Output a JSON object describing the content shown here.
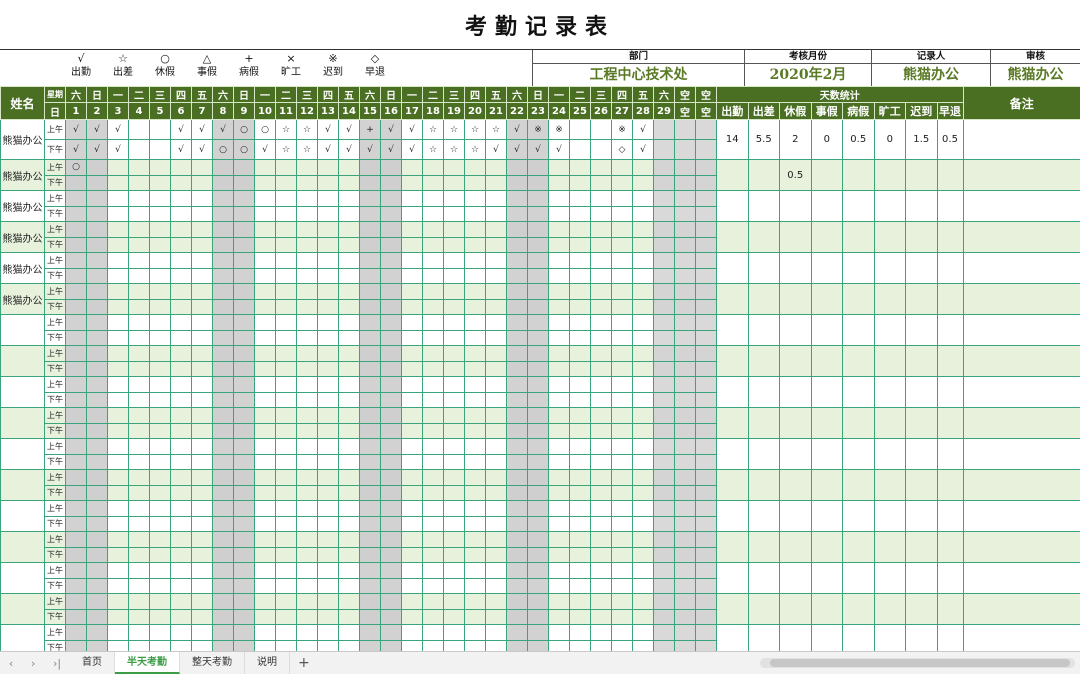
{
  "title": "考勤记录表",
  "legend": [
    {
      "sym": "√",
      "label": "出勤"
    },
    {
      "sym": "☆",
      "label": "出差"
    },
    {
      "sym": "○",
      "label": "休假"
    },
    {
      "sym": "△",
      "label": "事假"
    },
    {
      "sym": "+",
      "label": "病假"
    },
    {
      "sym": "×",
      "label": "旷工"
    },
    {
      "sym": "※",
      "label": "迟到"
    },
    {
      "sym": "◇",
      "label": "早退"
    }
  ],
  "meta": {
    "dept_label": "部门",
    "dept_value": "工程中心技术处",
    "month_label": "考核月份",
    "month_value": "2020年2月",
    "recorder_label": "记录人",
    "recorder_value": "熊猫办公",
    "review_label": "审核",
    "review_value": "熊猫办公"
  },
  "header": {
    "name": "姓名",
    "week_label": "星期",
    "date_label": "日",
    "weekdays": [
      "六",
      "日",
      "一",
      "二",
      "三",
      "四",
      "五",
      "六",
      "日",
      "一",
      "二",
      "三",
      "四",
      "五",
      "六",
      "日",
      "一",
      "二",
      "三",
      "四",
      "五",
      "六",
      "日",
      "一",
      "二",
      "三",
      "四",
      "五",
      "六",
      "空",
      "空"
    ],
    "days": [
      "1",
      "2",
      "3",
      "4",
      "5",
      "6",
      "7",
      "8",
      "9",
      "10",
      "11",
      "12",
      "13",
      "14",
      "15",
      "16",
      "17",
      "18",
      "19",
      "20",
      "21",
      "22",
      "23",
      "24",
      "25",
      "26",
      "27",
      "28",
      "29",
      "空",
      "空"
    ],
    "stats_group": "天数统计",
    "stats": [
      "出勤",
      "出差",
      "休假",
      "事假",
      "病假",
      "旷工",
      "迟到",
      "早退"
    ],
    "remark": "备注"
  },
  "half_labels": {
    "am": "上午",
    "pm": "下午"
  },
  "rows": [
    {
      "name": "熊猫办公",
      "am": [
        "√",
        "√",
        "√",
        "",
        "",
        "√",
        "√",
        "√",
        "○",
        "○",
        "☆",
        "☆",
        "√",
        "√",
        "+",
        "√",
        "√",
        "☆",
        "☆",
        "☆",
        "☆",
        "√",
        "※",
        "※",
        "",
        "",
        "※",
        "√",
        "",
        "",
        ""
      ],
      "pm": [
        "√",
        "√",
        "√",
        "",
        "",
        "√",
        "√",
        "○",
        "○",
        "√",
        "☆",
        "☆",
        "√",
        "√",
        "√",
        "√",
        "√",
        "☆",
        "☆",
        "☆",
        "√",
        "√",
        "√",
        "√",
        "",
        "",
        "◇",
        "√",
        "",
        "",
        ""
      ],
      "stats": [
        "14",
        "5.5",
        "2",
        "0",
        "0.5",
        "0",
        "1.5",
        "0.5"
      ]
    },
    {
      "name": "熊猫办公",
      "am": [
        "○",
        "",
        "",
        "",
        "",
        "",
        "",
        "",
        "",
        "",
        "",
        "",
        "",
        "",
        "",
        "",
        "",
        "",
        "",
        "",
        "",
        "",
        "",
        "",
        "",
        "",
        "",
        "",
        "",
        "",
        ""
      ],
      "pm": [
        "",
        "",
        "",
        "",
        "",
        "",
        "",
        "",
        "",
        "",
        "",
        "",
        "",
        "",
        "",
        "",
        "",
        "",
        "",
        "",
        "",
        "",
        "",
        "",
        "",
        "",
        "",
        "",
        "",
        "",
        ""
      ],
      "stats": [
        "",
        "",
        "0.5",
        "",
        "",
        "",
        "",
        ""
      ]
    },
    {
      "name": "熊猫办公",
      "am": [],
      "pm": [],
      "stats": []
    },
    {
      "name": "熊猫办公",
      "am": [],
      "pm": [],
      "stats": []
    },
    {
      "name": "熊猫办公",
      "am": [],
      "pm": [],
      "stats": []
    },
    {
      "name": "熊猫办公",
      "am": [],
      "pm": [],
      "stats": []
    },
    {
      "name": "",
      "am": [],
      "pm": [],
      "stats": []
    },
    {
      "name": "",
      "am": [],
      "pm": [],
      "stats": []
    },
    {
      "name": "",
      "am": [],
      "pm": [],
      "stats": []
    },
    {
      "name": "",
      "am": [],
      "pm": [],
      "stats": []
    },
    {
      "name": "",
      "am": [],
      "pm": [],
      "stats": []
    },
    {
      "name": "",
      "am": [],
      "pm": [],
      "stats": []
    },
    {
      "name": "",
      "am": [],
      "pm": [],
      "stats": []
    },
    {
      "name": "",
      "am": [],
      "pm": [],
      "stats": []
    },
    {
      "name": "",
      "am": [],
      "pm": [],
      "stats": []
    },
    {
      "name": "",
      "am": [],
      "pm": [],
      "stats": []
    },
    {
      "name": "",
      "am": [],
      "pm": [],
      "stats": []
    }
  ],
  "tabs": [
    "首页",
    "半天考勤",
    "整天考勤",
    "说明"
  ],
  "active_tab": 1,
  "nav_icons": [
    "chevron-left-icon",
    "chevron-right-icon",
    "last-sheet-icon"
  ],
  "colors": {
    "header_bg": "#4a6e22",
    "accent": "#5a7a26",
    "weekend": "#d2d2d2",
    "band": "#e8f1dc",
    "active_tab": "#3d9c46"
  }
}
